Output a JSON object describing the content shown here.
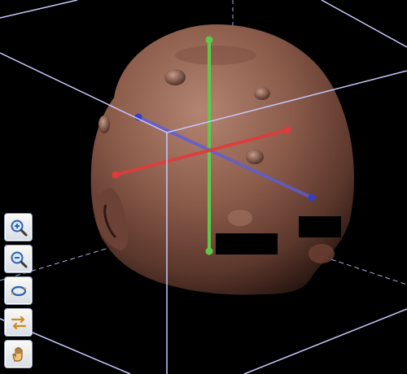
{
  "viewer": {
    "background_color": "#000000",
    "bounding_box_color": "#c8c8ff",
    "head_color": "#8a5a4a"
  },
  "axes": [
    {
      "name": "vertical-axis",
      "color": "#5fc94a"
    },
    {
      "name": "left-right-axis",
      "color": "#e03b3b"
    },
    {
      "name": "front-back-axis",
      "color": "#4a52cc"
    }
  ],
  "toolbar": {
    "buttons": [
      {
        "name": "zoom-in-button",
        "icon": "zoom-in-icon"
      },
      {
        "name": "zoom-out-button",
        "icon": "zoom-out-icon"
      },
      {
        "name": "rotate-button",
        "icon": "rotate-icon"
      },
      {
        "name": "flip-button",
        "icon": "swap-arrows-icon"
      },
      {
        "name": "pan-button",
        "icon": "hand-icon"
      }
    ]
  }
}
